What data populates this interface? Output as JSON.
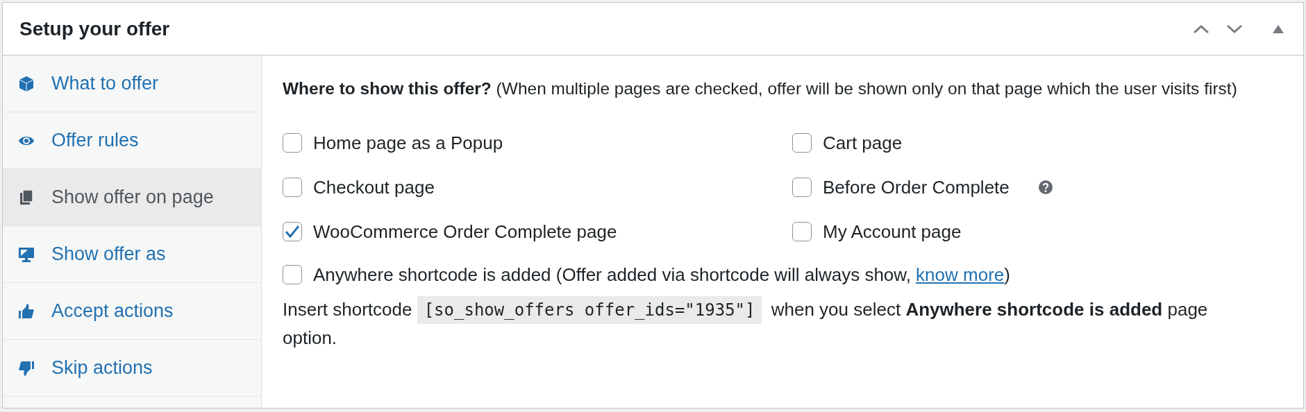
{
  "panel": {
    "title": "Setup your offer"
  },
  "sidebar": {
    "items": [
      {
        "label": "What to offer",
        "selected": false
      },
      {
        "label": "Offer rules",
        "selected": false
      },
      {
        "label": "Show offer on page",
        "selected": true
      },
      {
        "label": "Show offer as",
        "selected": false
      },
      {
        "label": "Accept actions",
        "selected": false
      },
      {
        "label": "Skip actions",
        "selected": false
      }
    ]
  },
  "content": {
    "question": "**Where to show this offer?** (When multiple pages are checked, offer will be shown only on that page which the user visits first)",
    "options": [
      {
        "label": "Home page as a Popup",
        "checked": false,
        "help": false
      },
      {
        "label": "Cart page",
        "checked": false,
        "help": false
      },
      {
        "label": "Checkout page",
        "checked": false,
        "help": false
      },
      {
        "label": "Before Order Complete",
        "checked": false,
        "help": true
      },
      {
        "label": "WooCommerce Order Complete page",
        "checked": true,
        "help": false
      },
      {
        "label": "My Account page",
        "checked": false,
        "help": false
      }
    ],
    "shortcode_option": {
      "label": "Anywhere shortcode is added (Offer added via shortcode will always show, ",
      "link": "know more",
      "label_end": ")",
      "checked": false
    },
    "shortcode_note": {
      "before": "Insert shortcode ",
      "code": "[so_show_offers offer_ids=\"1935\"]",
      "after": " when you select **Anywhere shortcode is added** page option."
    }
  }
}
